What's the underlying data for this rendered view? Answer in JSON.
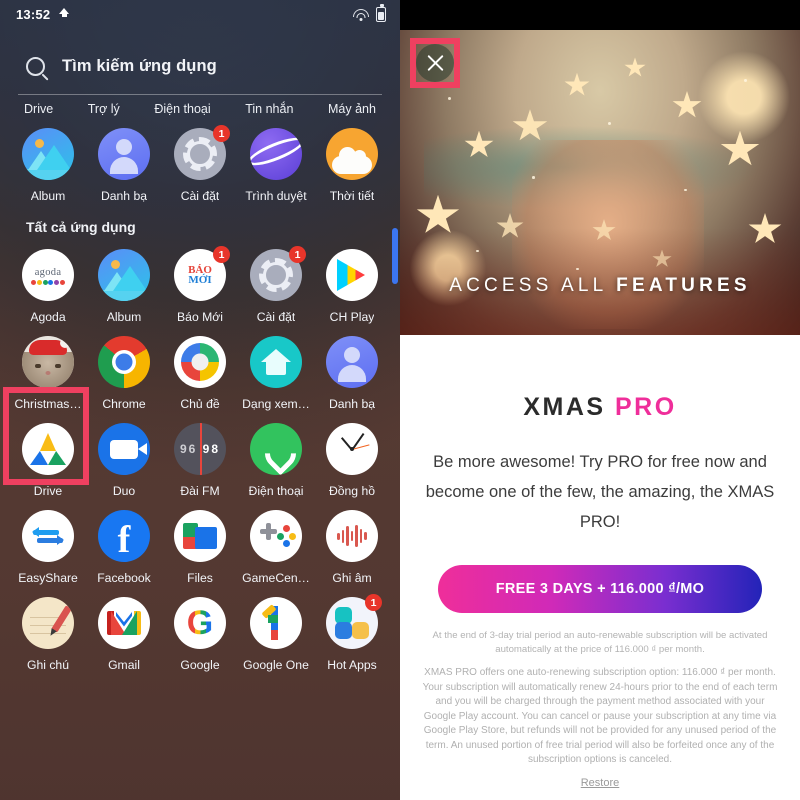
{
  "launcher": {
    "status_bar": {
      "time": "13:52",
      "upload_icon": "upload-icon",
      "wifi_icon": "wifi-icon",
      "battery_icon": "battery-icon"
    },
    "search": {
      "placeholder": "Tìm kiếm ứng dụng",
      "icon": "search-icon"
    },
    "suggestions": [
      "Drive",
      "Trợ lý",
      "Điện thoại",
      "Tin nhắn",
      "Máy ảnh"
    ],
    "favorites": [
      {
        "label": "Album",
        "icon": "photos-icon",
        "badge": ""
      },
      {
        "label": "Danh bạ",
        "icon": "contacts-icon",
        "badge": ""
      },
      {
        "label": "Cài đặt",
        "icon": "settings-icon",
        "badge": "1"
      },
      {
        "label": "Trình duyệt",
        "icon": "browser-icon",
        "badge": ""
      },
      {
        "label": "Thời tiết",
        "icon": "weather-icon",
        "badge": ""
      }
    ],
    "all_apps_title": "Tất cả ứng dụng",
    "apps": [
      {
        "label": "Agoda",
        "icon": "agoda-icon",
        "badge": ""
      },
      {
        "label": "Album",
        "icon": "photos-icon",
        "badge": ""
      },
      {
        "label": "Báo Mới",
        "icon": "baomoi-icon",
        "badge": "1"
      },
      {
        "label": "Cài đặt",
        "icon": "settings-icon",
        "badge": "1"
      },
      {
        "label": "CH Play",
        "icon": "play-store-icon",
        "badge": ""
      },
      {
        "label": "Christmas…",
        "icon": "christmas-cat-icon",
        "badge": ""
      },
      {
        "label": "Chrome",
        "icon": "chrome-icon",
        "badge": ""
      },
      {
        "label": "Chủ đề",
        "icon": "theme-icon",
        "badge": ""
      },
      {
        "label": "Dạng xem…",
        "icon": "home-icon",
        "badge": ""
      },
      {
        "label": "Danh bạ",
        "icon": "contacts-icon",
        "badge": ""
      },
      {
        "label": "Drive",
        "icon": "google-drive-icon",
        "badge": ""
      },
      {
        "label": "Duo",
        "icon": "duo-icon",
        "badge": ""
      },
      {
        "label": "Đài FM",
        "icon": "fm-radio-icon",
        "badge": ""
      },
      {
        "label": "Điện thoại",
        "icon": "phone-icon",
        "badge": ""
      },
      {
        "label": "Đồng hồ",
        "icon": "clock-icon",
        "badge": ""
      },
      {
        "label": "EasyShare",
        "icon": "easyshare-icon",
        "badge": ""
      },
      {
        "label": "Facebook",
        "icon": "facebook-icon",
        "badge": ""
      },
      {
        "label": "Files",
        "icon": "files-icon",
        "badge": ""
      },
      {
        "label": "GameCen…",
        "icon": "game-center-icon",
        "badge": ""
      },
      {
        "label": "Ghi âm",
        "icon": "recorder-icon",
        "badge": ""
      },
      {
        "label": "Ghi chú",
        "icon": "notes-icon",
        "badge": ""
      },
      {
        "label": "Gmail",
        "icon": "gmail-icon",
        "badge": ""
      },
      {
        "label": "Google",
        "icon": "google-icon",
        "badge": ""
      },
      {
        "label": "Google One",
        "icon": "google-one-icon",
        "badge": ""
      },
      {
        "label": "Hot Apps",
        "icon": "hot-apps-icon",
        "badge": "1"
      }
    ],
    "fm_radio": {
      "left": "96",
      "right": "98"
    },
    "agoda_text": "agoda",
    "baomoi_text_1": "BÁO",
    "baomoi_text_2": "MỚI",
    "google_letter": "G",
    "facebook_letter": "f",
    "highlight_color": "#ef4060",
    "scrollbar_color": "#3b76f0"
  },
  "paywall": {
    "close_icon": "close-icon",
    "hero_caption_regular": "ACCESS ALL ",
    "hero_caption_bold": "FEATURES",
    "brand_main": "XMAS ",
    "brand_pro": "PRO",
    "brand_pro_color": "#ef2e9a",
    "pitch": "Be more awesome! Try PRO for free now and become one of the few, the amazing, the XMAS PRO!",
    "cta_label": "FREE 3 DAYS + 116.000 ₫/MO",
    "fine_print_1": "At the end of 3-day trial period an auto-renewable subscription will be activated automatically at the price of 116.000 ₫ per month.",
    "fine_print_2": "XMAS PRO offers one auto-renewing subscription option: 116.000 ₫ per month. Your subscription will automatically renew 24-hours prior to the end of each term and you will be charged through the payment method associated with your Google Play account. You can cancel or pause your subscription at any time via Google Play Store, but refunds will not be provided for any unused period of the term. An unused portion of free trial period will also be forfeited once any of the subscription options is canceled.",
    "restore_label": "Restore"
  }
}
